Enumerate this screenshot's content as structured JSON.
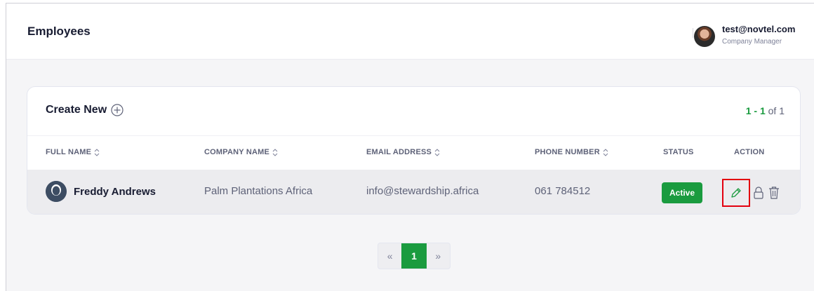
{
  "header": {
    "page_title": "Employees",
    "user": {
      "email": "test@novtel.com",
      "role": "Company Manager"
    }
  },
  "card": {
    "create_new_label": "Create New",
    "pager_range": "1 - 1",
    "pager_of": "of 1"
  },
  "table": {
    "columns": [
      "FULL NAME",
      "COMPANY NAME",
      "EMAIL ADDRESS",
      "PHONE NUMBER",
      "STATUS",
      "ACTION"
    ],
    "rows": [
      {
        "full_name": "Freddy Andrews",
        "company_name": "Palm Plantations Africa",
        "email": "info@stewardship.africa",
        "phone": "061 784512",
        "status": "Active"
      }
    ]
  },
  "pagination": {
    "prev": "«",
    "current": "1",
    "next": "»"
  },
  "colors": {
    "accent_green": "#1a9b3f",
    "highlight_red": "#e3000f"
  },
  "icons": [
    "user-avatar-icon",
    "plus-circle-icon",
    "sort-icon",
    "person-icon",
    "pencil-icon",
    "lock-icon",
    "trash-icon"
  ]
}
